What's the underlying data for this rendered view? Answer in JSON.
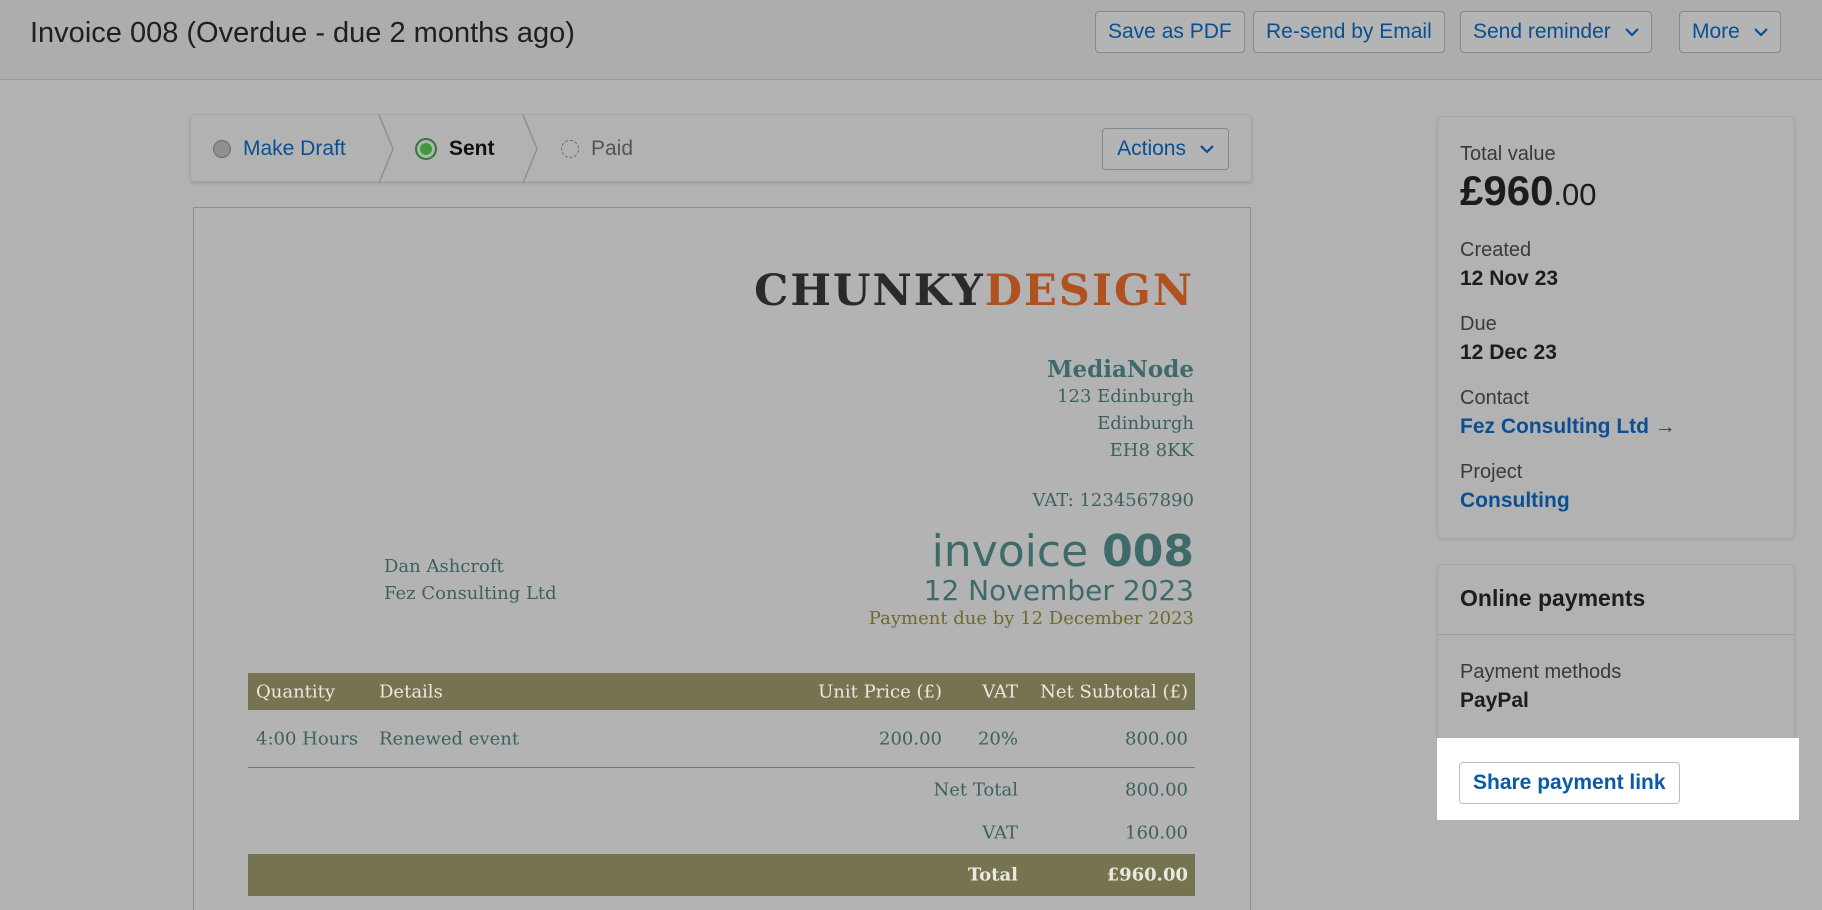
{
  "header": {
    "title": "Invoice 008 (Overdue - due 2 months ago)",
    "buttons": {
      "save_pdf": "Save as PDF",
      "resend_email": "Re-send by Email",
      "send_reminder": "Send reminder",
      "more": "More"
    }
  },
  "status_bar": {
    "steps": [
      {
        "label": "Make Draft",
        "state": "available"
      },
      {
        "label": "Sent",
        "state": "current"
      },
      {
        "label": "Paid",
        "state": "pending"
      }
    ],
    "actions_label": "Actions"
  },
  "invoice": {
    "logo": {
      "part1": "CHUNKY",
      "part2": "DESIGN"
    },
    "from": {
      "name": "MediaNode",
      "address1": "123 Edinburgh",
      "address2": "Edinburgh",
      "postcode": "EH8 8KK"
    },
    "vat_number": "VAT: 1234567890",
    "to": {
      "person": "Dan Ashcroft",
      "company": "Fez Consulting Ltd"
    },
    "word": "invoice",
    "number": "008",
    "date": "12 November 2023",
    "due_text": "Payment due by 12 December 2023",
    "table": {
      "headers": {
        "quantity": "Quantity",
        "details": "Details",
        "unit_price": "Unit Price (£)",
        "vat": "VAT",
        "net_subtotal": "Net Subtotal (£)"
      },
      "rows": [
        {
          "quantity": "4:00 Hours",
          "details": "Renewed event",
          "unit_price": "200.00",
          "vat": "20%",
          "net_subtotal": "800.00"
        }
      ],
      "net_total_label": "Net Total",
      "net_total": "800.00",
      "vat_label": "VAT",
      "vat_total": "160.00",
      "total_label": "Total",
      "total": "£960.00"
    }
  },
  "summary": {
    "total_value_label": "Total value",
    "total_value_main": "£960",
    "total_value_cents": ".00",
    "created_label": "Created",
    "created": "12 Nov 23",
    "due_label": "Due",
    "due": "12 Dec 23",
    "contact_label": "Contact",
    "contact": "Fez Consulting Ltd →",
    "project_label": "Project",
    "project": "Consulting"
  },
  "online_payments": {
    "title": "Online payments",
    "methods_label": "Payment methods",
    "methods": "PayPal",
    "share_button": "Share payment link"
  },
  "colors": {
    "link": "#0a4f94",
    "table_header": "#767450",
    "logo_accent": "#b0521f",
    "sent_green": "#3f9a3f"
  }
}
